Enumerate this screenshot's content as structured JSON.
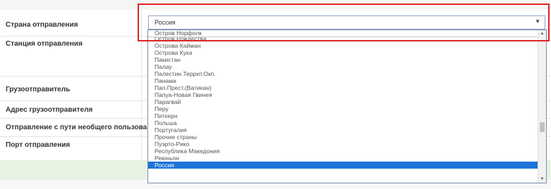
{
  "labels": {
    "departure_country": "Страна отправления",
    "departure_station": "Станция отправления",
    "shipper": "Грузоотправитель",
    "shipper_address": "Адрес грузоотправителя",
    "non_public_track": "Отправление с пути необщего пользования",
    "departure_port": "Порт отправления"
  },
  "country_select": {
    "value": "Россия",
    "options": [
      "Остров Норфолк",
      "Остров Рождества",
      "Острова Кайман",
      "Острова Кука",
      "Пакистан",
      "Палау",
      "Палестин.Террит.Окп.",
      "Панама",
      "Пап.Прест.(Ватикан)",
      "Папуа-Новая Гвинея",
      "Парагвай",
      "Перу",
      "Питкерн",
      "Польша",
      "Португалия",
      "Прочие страны",
      "Пуэрто-Рико",
      "Республика Македония",
      "Реюньон",
      "Россия"
    ],
    "selected_index": 19
  },
  "colors": {
    "highlight": "#1e73d8",
    "annotation_box": "#e02424",
    "section_band": "#e8f2e3"
  }
}
